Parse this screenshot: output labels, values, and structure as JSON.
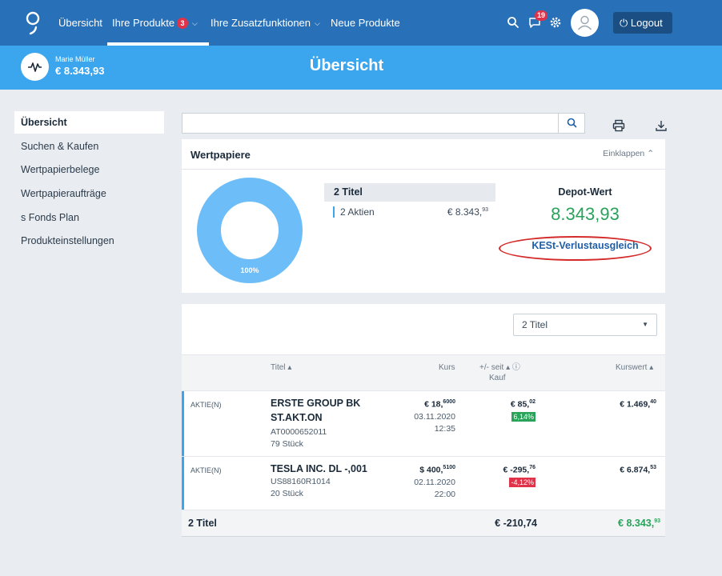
{
  "nav": {
    "items": [
      {
        "label": "Übersicht"
      },
      {
        "label": "Ihre Produkte",
        "badge": "3"
      },
      {
        "label": "Ihre Zusatzfunktionen"
      },
      {
        "label": "Neue Produkte"
      }
    ],
    "messages_badge": "19",
    "logout_label": "Logout"
  },
  "header": {
    "user_name": "Marie Müller",
    "balance": "€ 8.343,93",
    "page_title": "Übersicht"
  },
  "sidebar": {
    "items": [
      {
        "label": "Übersicht"
      },
      {
        "label": "Suchen & Kaufen"
      },
      {
        "label": "Wertpapierbelege"
      },
      {
        "label": "Wertpapieraufträge"
      },
      {
        "label": "s Fonds Plan"
      },
      {
        "label": "Produkteinstellungen"
      }
    ]
  },
  "search": {
    "value": ""
  },
  "portfolio": {
    "title": "Wertpapiere",
    "collapse_label": "Einklappen",
    "donut_percent": "100%",
    "titles_header": "2 Titel",
    "titles_row_label": "2 Aktien",
    "titles_row_value": "€ 8.343,",
    "titles_row_value_sup": "93",
    "depot_label": "Depot-Wert",
    "depot_value": "8.343,93",
    "kest_link": "KESt-Verlustausgleich"
  },
  "table": {
    "filter_value": "2 Titel",
    "headers": {
      "title": "Titel",
      "kurs": "Kurs",
      "change_line1": "+/- seit",
      "change_line2": "Kauf",
      "kurswert": "Kurswert"
    },
    "rows": [
      {
        "type": "AKTIE(N)",
        "name_line1": "ERSTE GROUP BK",
        "name_line2": "ST.AKT.ON",
        "isin": "AT0000652011",
        "qty": "79  Stück",
        "kurs": "€ 18,",
        "kurs_sup": "6000",
        "date": "03.11.2020",
        "time": "12:35",
        "change": "€ 85,",
        "change_sup": "02",
        "change_pct": "6,14%",
        "kurswert": "€ 1.469,",
        "kurswert_sup": "40"
      },
      {
        "type": "AKTIE(N)",
        "name_line1": "TESLA INC. DL -,001",
        "isin": "US88160R1014",
        "qty": "20  Stück",
        "kurs": "$ 400,",
        "kurs_sup": "5100",
        "date": "02.11.2020",
        "time": "22:00",
        "change": "€ -295,",
        "change_sup": "76",
        "change_pct": "-4,12%",
        "kurswert": "€ 6.874,",
        "kurswert_sup": "53"
      }
    ],
    "footer": {
      "label": "2 Titel",
      "change_total": "€ -210,74",
      "kurswert_total": "€ 8.343,",
      "kurswert_total_sup": "93"
    }
  },
  "colors": {
    "nav": "#2870b8",
    "header": "#3ba5ee",
    "positive": "#29a35a",
    "negative": "#e0334a",
    "highlight_oval": "#d42a2a"
  }
}
